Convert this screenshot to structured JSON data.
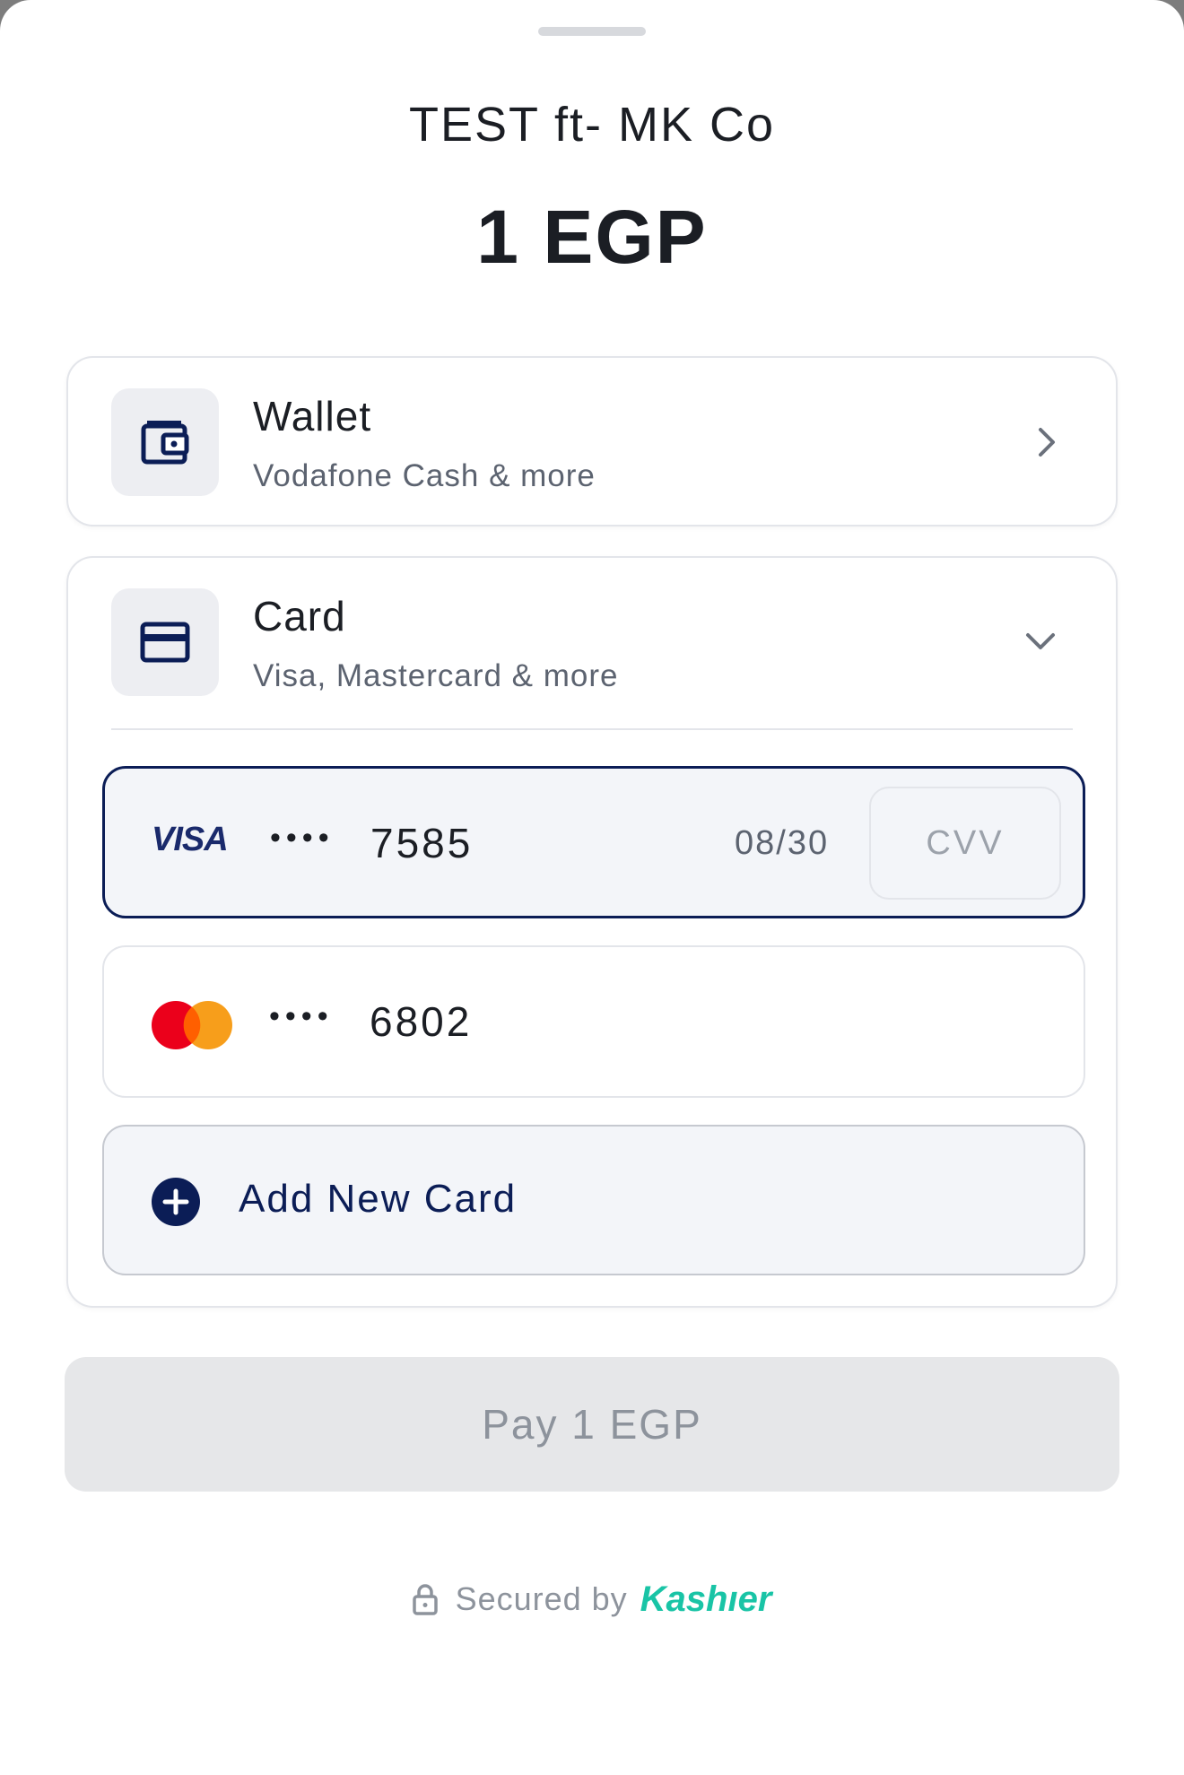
{
  "merchant": {
    "name": "TEST ft- MK Co",
    "amount": "1 EGP"
  },
  "methods": {
    "wallet": {
      "title": "Wallet",
      "subtitle": "Vodafone Cash & more",
      "icon": "wallet-icon"
    },
    "card": {
      "title": "Card",
      "subtitle": "Visa, Mastercard & more",
      "icon": "credit-card-icon"
    }
  },
  "saved_cards": [
    {
      "brand": "VISA",
      "mask": "••••",
      "last4": "7585",
      "expiry": "08/30",
      "cvv_placeholder": "CVV",
      "selected": true
    },
    {
      "brand": "mastercard",
      "mask": "••••",
      "last4": "6802",
      "selected": false
    }
  ],
  "add_card": {
    "label": "Add New Card"
  },
  "pay_button": {
    "label": "Pay 1 EGP",
    "enabled": false
  },
  "footer": {
    "secured_text": "Secured by",
    "brand": "Kashıer"
  },
  "colors": {
    "accent": "#0b1d56",
    "brand": "#19c4a6",
    "disabled_bg": "#e6e7e9",
    "disabled_text": "#8d939c"
  }
}
